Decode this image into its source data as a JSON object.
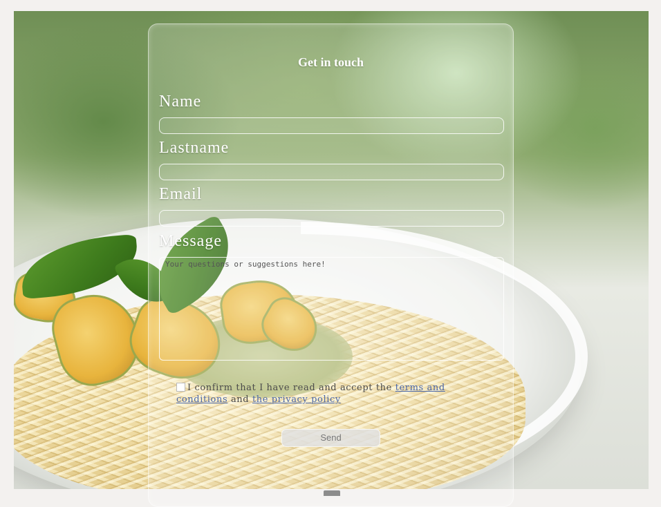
{
  "form": {
    "title": "Get in touch",
    "fields": {
      "name_label": "Name",
      "lastname_label": "Lastname",
      "email_label": "Email",
      "message_label": "Message",
      "name_value": "",
      "lastname_value": "",
      "email_value": "",
      "message_placeholder": "Your questions or suggestions here!"
    },
    "consent": {
      "checked": false,
      "text_before": "I confirm that I have read and accept the ",
      "terms_link": "terms and conditions",
      "text_between": " and ",
      "privacy_link": "the privacy policy"
    },
    "send_label": "Send"
  },
  "colors": {
    "label_text": "#ffffff",
    "link": "#4b67a8",
    "button_bg": "#e1e1e1"
  }
}
